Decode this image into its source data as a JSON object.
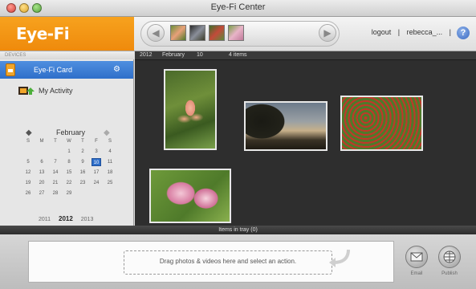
{
  "window": {
    "title": "Eye-Fi Center"
  },
  "header": {
    "logo": "Eye-Fi",
    "nav_prev_icon": "arrow-left-icon",
    "nav_next_icon": "arrow-right-icon",
    "links": {
      "logout": "logout",
      "separator": "|",
      "user": "rebecca_...",
      "separator2": "|"
    },
    "help": "?"
  },
  "sidebar": {
    "section_label": "DEVICES",
    "items": [
      {
        "label": "Eye-Fi Card",
        "icon": "memory-card-icon",
        "selected": true
      },
      {
        "label": "My Activity",
        "icon": "activity-icon",
        "selected": false
      }
    ],
    "gear": "⚙"
  },
  "calendar": {
    "month": "February",
    "prev": "◆",
    "next": "◆",
    "dow": [
      "S",
      "M",
      "T",
      "W",
      "T",
      "F",
      "S"
    ],
    "weeks": [
      [
        "",
        "",
        "",
        "1",
        "2",
        "3",
        "4"
      ],
      [
        "5",
        "6",
        "7",
        "8",
        "9",
        "10",
        "11"
      ],
      [
        "12",
        "13",
        "14",
        "15",
        "16",
        "17",
        "18"
      ],
      [
        "19",
        "20",
        "21",
        "22",
        "23",
        "24",
        "25"
      ],
      [
        "26",
        "27",
        "28",
        "29",
        "",
        "",
        ""
      ]
    ],
    "selected_day": "10",
    "years": [
      "2011",
      "2012",
      "2013"
    ],
    "current_year": "2012"
  },
  "breadcrumb": {
    "year": "2012",
    "month": "February",
    "day": "10",
    "count": "4 items"
  },
  "tray": {
    "bar_label": "Items in tray (0)",
    "drop_text": "Drag photos & videos here and select an action.",
    "email_label": "Email",
    "publish_label": "Publish"
  },
  "colors": {
    "brand": "#ef8a0c",
    "selection": "#2f6fca",
    "main_bg": "#2e2e2e"
  }
}
